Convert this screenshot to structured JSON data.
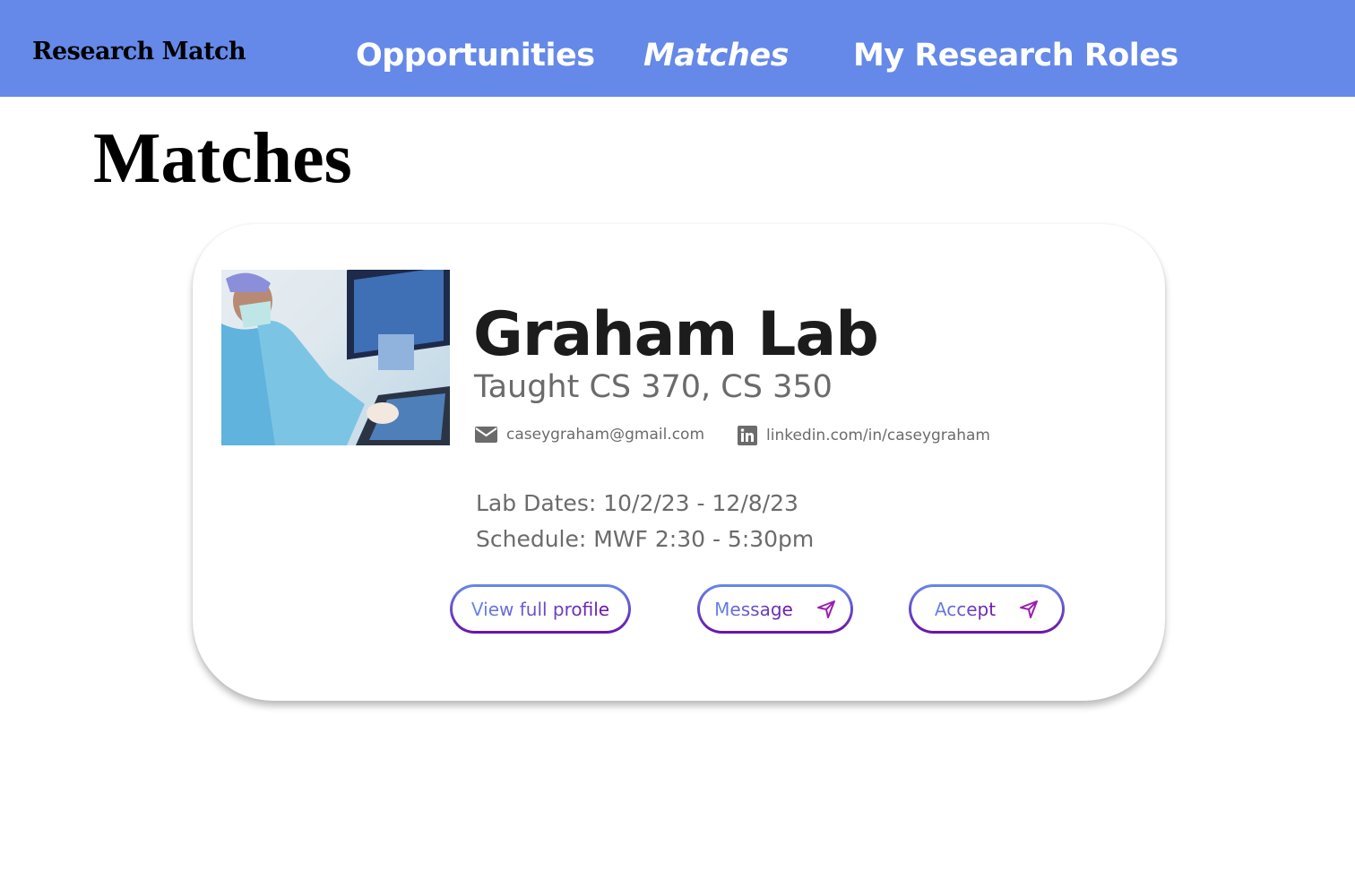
{
  "nav": {
    "brand": "Research Match",
    "links": [
      {
        "label": "Opportunities"
      },
      {
        "label": "Matches",
        "active": true
      },
      {
        "label": "My Research Roles"
      }
    ],
    "color": "#6589e8"
  },
  "page": {
    "title": "Matches"
  },
  "match": {
    "name": "Graham Lab",
    "taught": "Taught CS 370, CS 350",
    "email": "caseygraham@gmail.com",
    "linkedin": "linkedin.com/in/caseygraham",
    "dates": "Lab Dates: 10/2/23 - 12/8/23",
    "schedule": "Schedule: MWF 2:30 - 5:30pm",
    "image": "lab-researchers-photo"
  },
  "actions": {
    "view": "View full profile",
    "message": "Message",
    "accept": "Accept",
    "icon": "send-icon",
    "gradient": [
      "#6589e8",
      "#6a13a8"
    ]
  }
}
